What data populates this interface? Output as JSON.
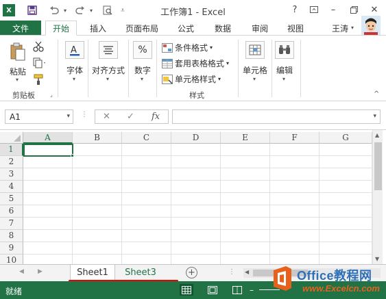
{
  "window": {
    "title": "工作簿1 - Excel",
    "help_label": "?",
    "user_name": "王涛"
  },
  "tabs": {
    "file": "文件",
    "items": [
      "开始",
      "插入",
      "页面布局",
      "公式",
      "数据",
      "审阅",
      "视图"
    ],
    "active": "开始"
  },
  "ribbon": {
    "clipboard": {
      "paste": "粘贴",
      "group": "剪贴板"
    },
    "font": {
      "label": "字体"
    },
    "alignment": {
      "label": "对齐方式"
    },
    "number": {
      "label": "数字",
      "icon_text": "%"
    },
    "styles": {
      "conditional": "条件格式",
      "table": "套用表格格式",
      "cell": "单元格样式",
      "group": "样式"
    },
    "cells": {
      "label": "单元格"
    },
    "editing": {
      "label": "编辑"
    }
  },
  "formula_bar": {
    "name_box": "A1",
    "fx": "fx"
  },
  "grid": {
    "columns": [
      "A",
      "B",
      "C",
      "D",
      "E",
      "F",
      "G"
    ],
    "rows": [
      "1",
      "2",
      "3",
      "4",
      "5",
      "6",
      "7",
      "8",
      "9",
      "10"
    ],
    "active_cell": "A1"
  },
  "sheets": {
    "tabs": [
      "Sheet1",
      "Sheet3"
    ],
    "active": "Sheet1",
    "add": "+"
  },
  "status": {
    "text": "就绪"
  },
  "watermark": {
    "line1": "Office教程网",
    "line2": "www.Excelcn.com"
  },
  "colors": {
    "accent": "#217346",
    "annotation": "#ee0000"
  }
}
